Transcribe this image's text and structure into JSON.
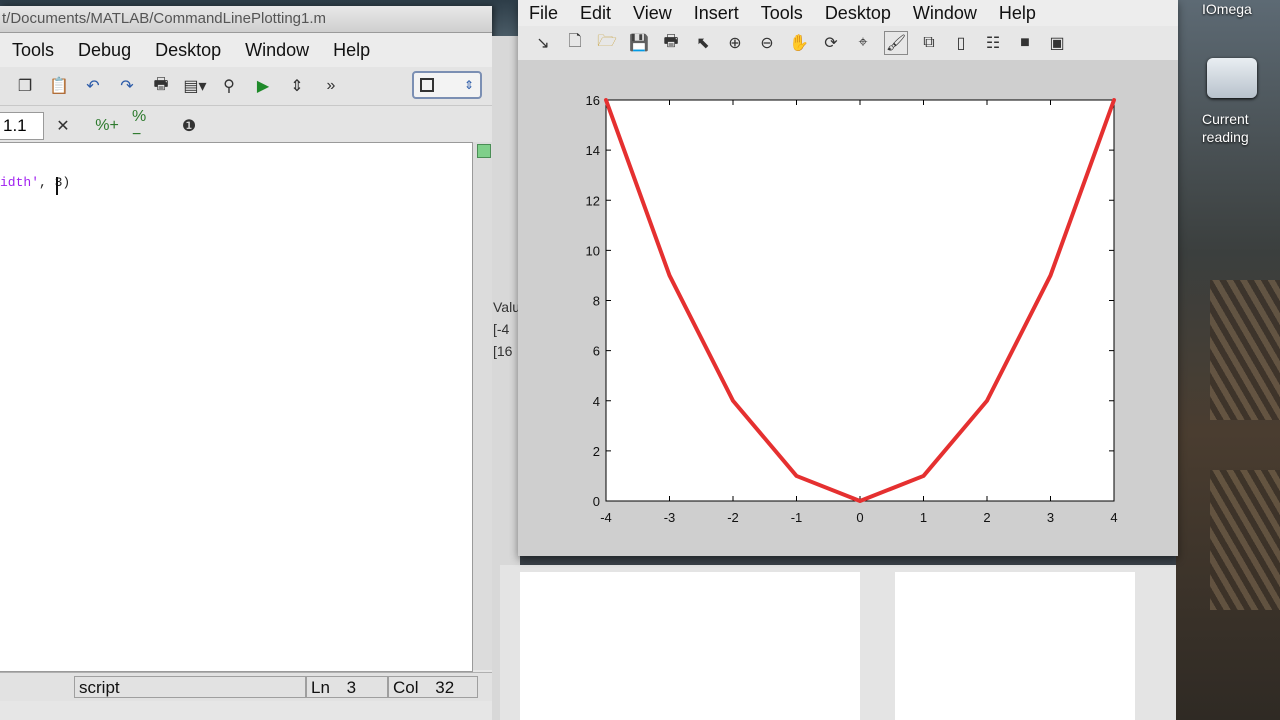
{
  "editor": {
    "path": "t/Documents/MATLAB/CommandLinePlotting1.m",
    "menu": [
      "Tools",
      "Debug",
      "Desktop",
      "Window",
      "Help"
    ],
    "cell_value": "1.1",
    "code_fragment_str": "idth'",
    "code_fragment_rest": ", 3)",
    "status": {
      "mode": "script",
      "ln_label": "Ln",
      "ln_value": "3",
      "col_label": "Col",
      "col_value": "32"
    }
  },
  "workspace_strip": [
    "Valu",
    "[-4",
    "[16"
  ],
  "figure": {
    "menu": [
      "File",
      "Edit",
      "View",
      "Insert",
      "Tools",
      "Desktop",
      "Window",
      "Help"
    ],
    "toolbar_icons": [
      "arrow-icon",
      "new-figure-icon",
      "open-icon",
      "save-icon",
      "print-icon",
      "select-icon",
      "zoom-in-icon",
      "zoom-out-icon",
      "pan-icon",
      "rotate-icon",
      "data-cursor-icon",
      "brush-icon",
      "link-icon",
      "colorbar-icon",
      "legend-icon",
      "hide-plot-tools-icon",
      "show-plot-tools-icon"
    ]
  },
  "desktop": {
    "labels": [
      "IOmega",
      "Current",
      "reading"
    ]
  },
  "chart_data": {
    "type": "line",
    "x": [
      -4,
      -3,
      -2,
      -1,
      0,
      1,
      2,
      3,
      4
    ],
    "series": [
      {
        "values": [
          16,
          9,
          4,
          1,
          0,
          1,
          4,
          9,
          16
        ],
        "color": "#e53030"
      }
    ],
    "xlim": [
      -4,
      4
    ],
    "ylim": [
      0,
      16
    ],
    "xticks": [
      "-4",
      "-3",
      "-2",
      "-1",
      "0",
      "1",
      "2",
      "3",
      "4"
    ],
    "yticks": [
      "0",
      "2",
      "4",
      "6",
      "8",
      "10",
      "12",
      "14",
      "16"
    ],
    "title": "",
    "xlabel": "",
    "ylabel": "",
    "grid": false
  }
}
